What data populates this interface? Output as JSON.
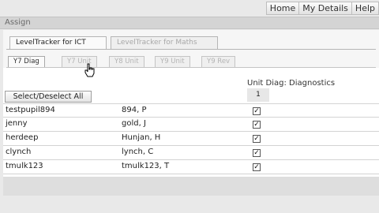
{
  "topnav": {
    "items": [
      "Home",
      "My Details",
      "Help"
    ]
  },
  "assign_bar": {
    "label": "Assign"
  },
  "tracker_tabs": [
    {
      "label": "LevelTracker for ICT",
      "active": true
    },
    {
      "label": "LevelTracker for Maths",
      "active": false
    }
  ],
  "unit_tabs": [
    {
      "label": "Y7 Diag",
      "active": true
    },
    {
      "label": "Y7 Unit",
      "active": false
    },
    {
      "label": "Y8 Unit",
      "active": false
    },
    {
      "label": "Y9 Unit",
      "active": false
    },
    {
      "label": "Y9 Rev",
      "active": false
    }
  ],
  "grid": {
    "unit_title": "Unit Diag: Diagnostics",
    "column_number": "1",
    "select_all_label": "Select/Deselect All",
    "rows": [
      {
        "username": "testpupil894",
        "name": "894, P",
        "checked": true
      },
      {
        "username": "jenny",
        "name": "gold, J",
        "checked": true
      },
      {
        "username": "herdeep",
        "name": "Hunjan, H",
        "checked": true
      },
      {
        "username": "clynch",
        "name": "lynch, C",
        "checked": true
      },
      {
        "username": "tmulk123",
        "name": "tmulk123, T",
        "checked": true
      }
    ],
    "check_mark": "✓"
  }
}
